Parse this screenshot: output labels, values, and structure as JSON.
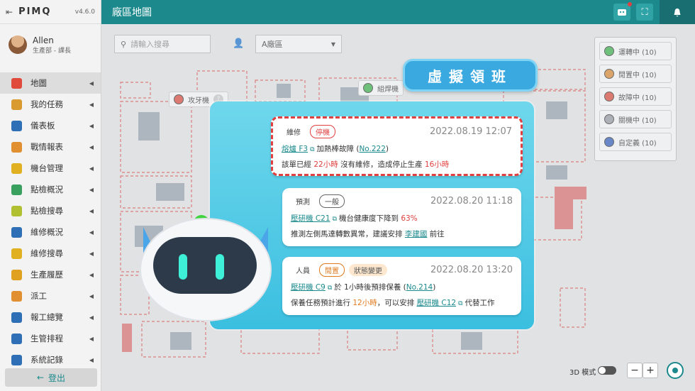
{
  "app": {
    "logo": "PIMQ",
    "version": "v4.6.0",
    "page_title": "廠區地圖"
  },
  "user": {
    "name": "Allen",
    "role": "生產部 - 課長"
  },
  "menu": [
    {
      "label": "地圖",
      "icon": "map-pin-icon",
      "color": "#e04a3a"
    },
    {
      "label": "我的任務",
      "icon": "user-icon",
      "color": "#d99a30"
    },
    {
      "label": "儀表板",
      "icon": "dashboard-icon",
      "color": "#2f6fb5"
    },
    {
      "label": "戰情報表",
      "icon": "report-icon",
      "color": "#e09030"
    },
    {
      "label": "機台管理",
      "icon": "alert-icon",
      "color": "#e0b020"
    },
    {
      "label": "點檢概況",
      "icon": "check-icon",
      "color": "#3aa060"
    },
    {
      "label": "點檢搜尋",
      "icon": "search-check-icon",
      "color": "#b0c030"
    },
    {
      "label": "維修概況",
      "icon": "wrench-icon",
      "color": "#2f6fb5"
    },
    {
      "label": "維修搜尋",
      "icon": "search-wrench-icon",
      "color": "#e0b020"
    },
    {
      "label": "生產履歷",
      "icon": "history-icon",
      "color": "#e0a020"
    },
    {
      "label": "派工",
      "icon": "dispatch-icon",
      "color": "#e09030"
    },
    {
      "label": "報工總覽",
      "icon": "overview-icon",
      "color": "#2f6fb5"
    },
    {
      "label": "生管排程",
      "icon": "calendar-icon",
      "color": "#2f6fb5"
    },
    {
      "label": "系統記錄",
      "icon": "clock-icon",
      "color": "#2f6fb5"
    }
  ],
  "logout": "登出",
  "search": {
    "placeholder": "請輸入搜尋"
  },
  "area_select": {
    "value": "A廠區"
  },
  "legend": [
    {
      "label": "運轉中 (10)",
      "color": "#3ab54a"
    },
    {
      "label": "閒置中 (10)",
      "color": "#e08a30"
    },
    {
      "label": "故障中 (10)",
      "color": "#e04a3a"
    },
    {
      "label": "關機中 (10)",
      "color": "#9a9ea6"
    },
    {
      "label": "自定義 (10)",
      "color": "#2f5fc0"
    }
  ],
  "map_pins": [
    {
      "label": "攻牙機",
      "color": "#e04a3a",
      "badge": "?"
    },
    {
      "label": "組焊機",
      "color": "#3ab54a"
    }
  ],
  "virtual_leader": "虛擬領班",
  "cards": [
    {
      "tags": [
        "維修",
        "停機"
      ],
      "time": "2022.08.19  12:07",
      "l1": {
        "link": "熔爐 F3",
        "text": "加熱棒故障 (",
        "ref": "No.222",
        "end": ")"
      },
      "l2": {
        "a": "該單已經 ",
        "b": "22小時",
        "c": " 沒有維修，造成停止生產 ",
        "d": "16小時"
      }
    },
    {
      "tags": [
        "預測",
        "一般"
      ],
      "time": "2022.08.20  11:18",
      "l1": {
        "link": "壓研機 C21",
        "text": "機台健康度下降到 ",
        "val": "63%"
      },
      "l2": {
        "a": "推測左側馬達轉數異常，建議安排 ",
        "name": "李建國",
        "c": " 前往"
      }
    },
    {
      "tags": [
        "人員",
        "閒置",
        "狀態變更"
      ],
      "time": "2022.08.20  13:20",
      "l1": {
        "link": "壓研機 C9",
        "text": "於 1小時後預排保養 (",
        "ref": "No.214",
        "end": ")"
      },
      "l2": {
        "a": "保養任務預計進行 ",
        "b": "12小時",
        "c": "，可以安排 ",
        "link": "壓研機 C12",
        "d": "代替工作"
      }
    }
  ],
  "mode3d": "3D 模式",
  "zoom": {
    "minus": "−",
    "plus": "+"
  }
}
